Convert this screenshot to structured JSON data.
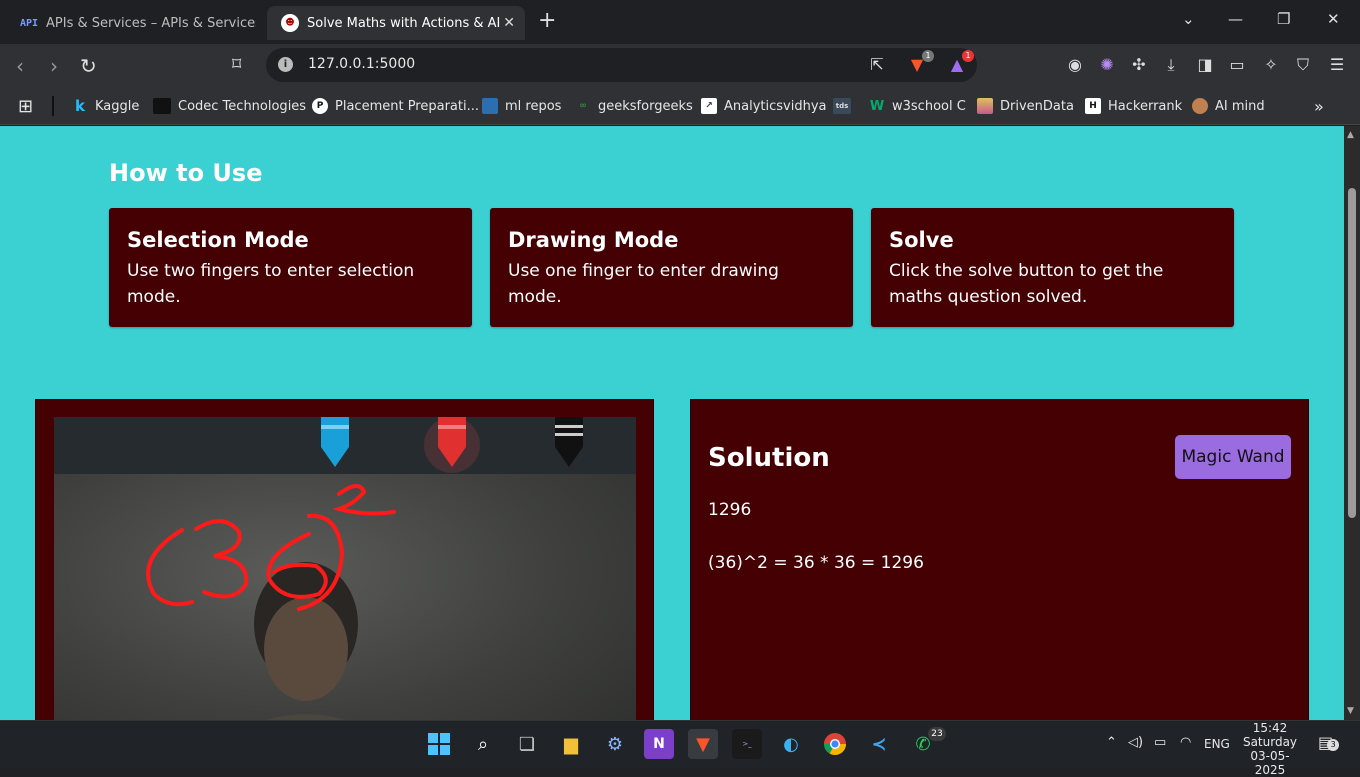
{
  "browser": {
    "tabs": [
      {
        "label": "APIs & Services – APIs & Services –",
        "icon": "API"
      },
      {
        "label": "Solve Maths with Actions & AI",
        "close": "✕"
      }
    ],
    "new_tab": "+",
    "url": "127.0.0.1:5000",
    "shield_badge": "1",
    "rewards_badge": "1"
  },
  "bookmarks": [
    {
      "label": "Kaggle",
      "icon_text": "k",
      "icon_color": "#20beff"
    },
    {
      "label": "Codec Technologies",
      "icon_text": "",
      "icon_color": "#111111"
    },
    {
      "label": "Placement Preparati...",
      "icon_text": "P",
      "icon_color": "#ffffff"
    },
    {
      "label": "ml repos",
      "icon_text": "",
      "icon_color": "#2c6fb0"
    },
    {
      "label": "geeksforgeeks",
      "icon_text": "GG",
      "icon_color": "#2f8d46"
    },
    {
      "label": "Analyticsvidhya",
      "icon_text": "",
      "icon_color": "#ffffff"
    },
    {
      "label": "tds",
      "icon_text": "tds",
      "icon_color": "#3b4a5a"
    },
    {
      "label": "w3school C",
      "icon_text": "W",
      "icon_color": "#04aa6d"
    },
    {
      "label": "DrivenData",
      "icon_text": "",
      "icon_color": "#e0c060"
    },
    {
      "label": "Hackerrank",
      "icon_text": "H",
      "icon_color": "#1ba94c"
    },
    {
      "label": "AI mind",
      "icon_text": "",
      "icon_color": "#c08050"
    }
  ],
  "page": {
    "heading": "How to Use",
    "cards": [
      {
        "title": "Selection Mode",
        "text": "Use two fingers to enter selection mode."
      },
      {
        "title": "Drawing Mode",
        "text": "Use one finger to enter drawing mode."
      },
      {
        "title": "Solve",
        "text": "Click the solve button to get the maths question solved."
      }
    ],
    "solution": {
      "title": "Solution",
      "button": "Magic Wand",
      "answer": "1296",
      "steps": "(36)^2 = 36 * 36 = 1296"
    },
    "crayon_colors": [
      "#1aa0d8",
      "#e03030",
      "#111111"
    ],
    "drawing_color": "#ff1a1a",
    "background_color": "#3bd1d3",
    "panel_color": "#440003",
    "button_color": "#9b6be0"
  },
  "taskbar": {
    "whatsapp_badge": "23",
    "language": "ENG",
    "time": "15:42",
    "day": "Saturday",
    "date": "03-05-2025",
    "notification_count": "3"
  }
}
